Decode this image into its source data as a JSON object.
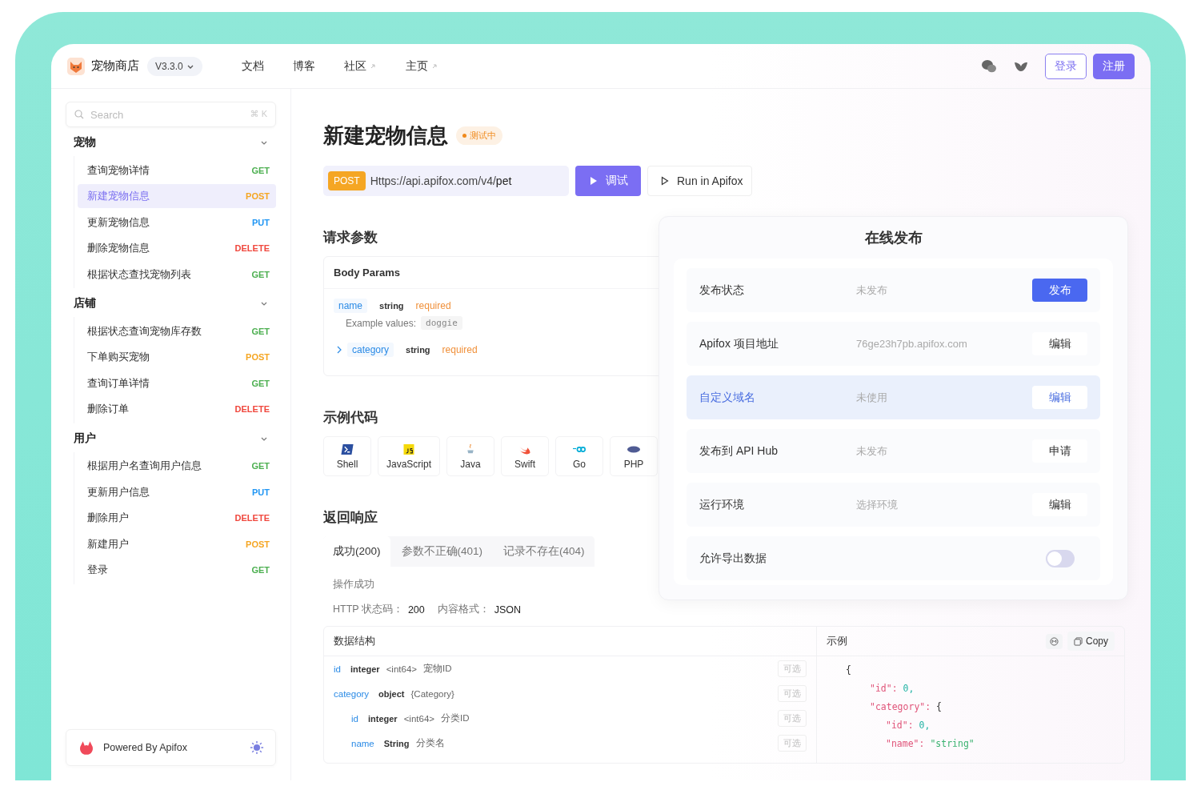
{
  "app": {
    "name": "宠物商店",
    "version": "V3.3.0"
  },
  "nav": [
    {
      "label": "文档",
      "external": false
    },
    {
      "label": "博客",
      "external": false
    },
    {
      "label": "社区",
      "external": true
    },
    {
      "label": "主页",
      "external": true
    }
  ],
  "auth": {
    "login": "登录",
    "register": "注册"
  },
  "search": {
    "placeholder": "Search",
    "shortcut": "⌘ K"
  },
  "sidebar": {
    "groups": [
      {
        "label": "宠物",
        "expanded": true,
        "items": [
          {
            "label": "查询宠物详情",
            "method": "GET",
            "selected": false
          },
          {
            "label": "新建宠物信息",
            "method": "POST",
            "selected": true
          },
          {
            "label": "更新宠物信息",
            "method": "PUT",
            "selected": false
          },
          {
            "label": "删除宠物信息",
            "method": "DELETE",
            "selected": false
          },
          {
            "label": "根据状态查找宠物列表",
            "method": "GET",
            "selected": false
          }
        ]
      },
      {
        "label": "店铺",
        "expanded": true,
        "items": [
          {
            "label": "根据状态查询宠物库存数",
            "method": "GET",
            "selected": false
          },
          {
            "label": "下单购买宠物",
            "method": "POST",
            "selected": false
          },
          {
            "label": "查询订单详情",
            "method": "GET",
            "selected": false
          },
          {
            "label": "删除订单",
            "method": "DELETE",
            "selected": false
          }
        ]
      },
      {
        "label": "用户",
        "expanded": true,
        "items": [
          {
            "label": "根据用户名查询用户信息",
            "method": "GET",
            "selected": false
          },
          {
            "label": "更新用户信息",
            "method": "PUT",
            "selected": false
          },
          {
            "label": "删除用户",
            "method": "DELETE",
            "selected": false
          },
          {
            "label": "新建用户",
            "method": "POST",
            "selected": false
          },
          {
            "label": "登录",
            "method": "GET",
            "selected": false
          }
        ]
      }
    ]
  },
  "footer": {
    "text": "Powered By Apifox"
  },
  "page": {
    "title": "新建宠物信息",
    "status": "测试中",
    "method": "POST",
    "url": "Https://api.apifox.com/v4/",
    "url_path": "pet",
    "debug_button": "调试",
    "run_button": "Run in Apifox"
  },
  "request": {
    "heading": "请求参数",
    "body_title": "Body Params",
    "params": [
      {
        "name": "name",
        "type": "string",
        "required": "required",
        "example_label": "Example values:",
        "example": "doggie",
        "expandable": false
      },
      {
        "name": "category",
        "type": "string",
        "required": "required",
        "expandable": true
      }
    ]
  },
  "code": {
    "heading": "示例代码",
    "languages": [
      {
        "label": "Shell",
        "kind": "shell"
      },
      {
        "label": "JavaScript",
        "kind": "js"
      },
      {
        "label": "Java",
        "kind": "java"
      },
      {
        "label": "Swift",
        "kind": "swift"
      },
      {
        "label": "Go",
        "kind": "go"
      },
      {
        "label": "PHP",
        "kind": "php"
      }
    ]
  },
  "response": {
    "heading": "返回响应",
    "tabs": [
      {
        "label": "成功(200)",
        "selected": true
      },
      {
        "label": "参数不正确(401)",
        "selected": false
      },
      {
        "label": "记录不存在(404)",
        "selected": false
      }
    ],
    "description": "操作成功",
    "status_label": "HTTP 状态码：",
    "status": "200",
    "format_label": "内容格式：",
    "format": "JSON",
    "schema_title": "数据结构",
    "fields": [
      {
        "name": "id",
        "type": "integer",
        "format": "<int64>",
        "description": "宠物ID",
        "optional": "可选"
      },
      {
        "name": "category",
        "type": "object",
        "format": "{Category}",
        "optional": "可选",
        "children": [
          {
            "name": "id",
            "type": "integer",
            "format": "<int64>",
            "description": "分类ID",
            "optional": "可选"
          },
          {
            "name": "name",
            "type": "String",
            "description": "分类名",
            "optional": "可选"
          }
        ]
      }
    ],
    "example_title": "示例",
    "copy": "Copy",
    "example": {
      "open": "{",
      "entries": [
        {
          "key": "\"id\":",
          "value": "0,",
          "kind": "number"
        },
        {
          "key": "\"category\":",
          "value": "{",
          "kind": "object",
          "children": [
            {
              "key": "\"id\":",
              "value": "0,",
              "kind": "number"
            },
            {
              "key": "\"name\":",
              "value": "\"string\"",
              "kind": "string"
            }
          ]
        }
      ]
    }
  },
  "publish": {
    "title": "在线发布",
    "rows": [
      {
        "label": "发布状态",
        "value": "未发布",
        "action": "发布",
        "kind": "primary",
        "selected": false
      },
      {
        "label": "Apifox 项目地址",
        "value": "76ge23h7pb.apifox.com",
        "action": "编辑",
        "kind": "link",
        "selected": false
      },
      {
        "label": "自定义域名",
        "value": "未使用",
        "action": "编辑",
        "kind": "link",
        "selected": true
      },
      {
        "label": "发布到 API Hub",
        "value": "未发布",
        "action": "申请",
        "kind": "link",
        "selected": false
      },
      {
        "label": "运行环境",
        "value": "选择环境",
        "action": "编辑",
        "kind": "link",
        "selected": false
      },
      {
        "label": "允许导出数据",
        "kind": "toggle",
        "on": false,
        "selected": false
      }
    ]
  }
}
